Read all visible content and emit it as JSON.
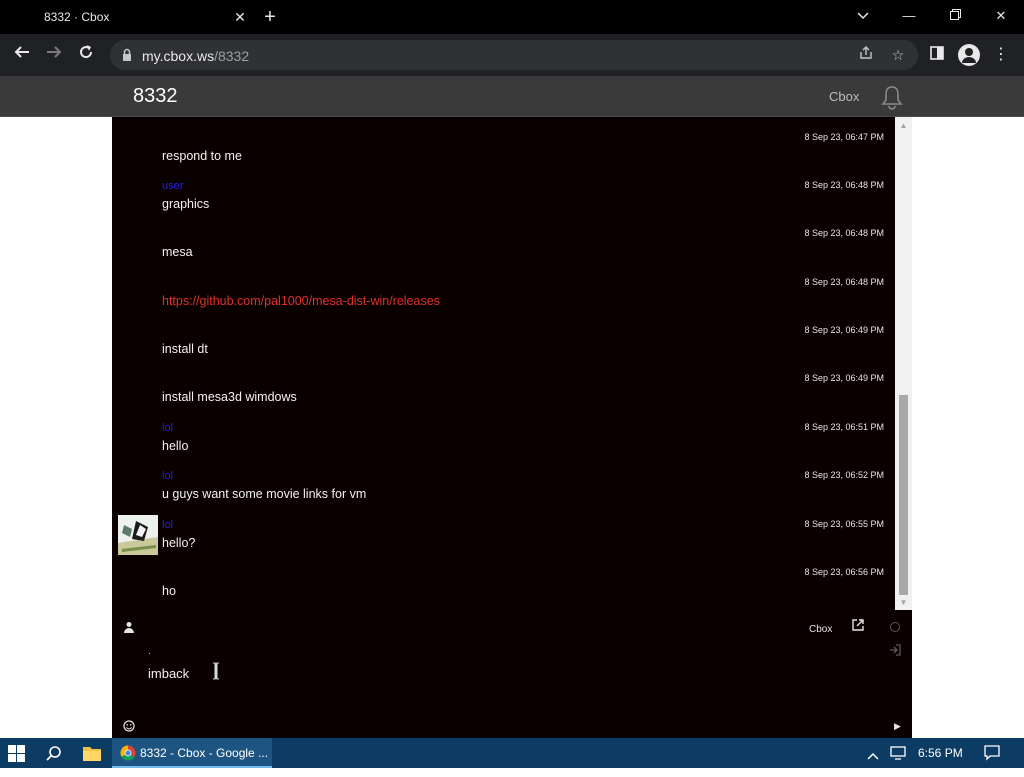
{
  "browser": {
    "tab_title": "8332 · Cbox",
    "url_host": "my.cbox.ws",
    "url_path": "/8332"
  },
  "cbox": {
    "title": "8332",
    "brand": "Cbox"
  },
  "messages": [
    {
      "nick": "",
      "time": "8 Sep 23, 06:47 PM",
      "text": "respond to me",
      "link": false,
      "avatar": false
    },
    {
      "nick": "user",
      "time": "8 Sep 23, 06:48 PM",
      "text": "graphics",
      "link": false,
      "avatar": false
    },
    {
      "nick": "",
      "time": "8 Sep 23, 06:48 PM",
      "text": "mesa",
      "link": false,
      "avatar": false
    },
    {
      "nick": "",
      "time": "8 Sep 23, 06:48 PM",
      "text": "https://github.com/pal1000/mesa-dist-win/releases",
      "link": true,
      "avatar": false
    },
    {
      "nick": "",
      "time": "8 Sep 23, 06:49 PM",
      "text": "install dt",
      "link": false,
      "avatar": false
    },
    {
      "nick": "",
      "time": "8 Sep 23, 06:49 PM",
      "text": "install mesa3d wimdows",
      "link": false,
      "avatar": false
    },
    {
      "nick": "lol",
      "time": "8 Sep 23, 06:51 PM",
      "text": "hello",
      "link": false,
      "avatar": false
    },
    {
      "nick": "lol",
      "time": "8 Sep 23, 06:52 PM",
      "text": "u guys want some movie links for vm",
      "link": false,
      "avatar": false
    },
    {
      "nick": "lol",
      "time": "8 Sep 23, 06:55 PM",
      "text": "hello?",
      "link": false,
      "avatar": true
    },
    {
      "nick": "",
      "time": "8 Sep 23, 06:56 PM",
      "text": "ho",
      "link": false,
      "avatar": false
    }
  ],
  "input": {
    "brand_label": "Cbox",
    "name_placeholder": ".",
    "message_value": "imback"
  },
  "taskbar": {
    "chrome_label": "8332 - Cbox - Google ...",
    "clock": "6:56 PM"
  },
  "colors": {
    "chat_bg": "#0a0000",
    "nick": "#2424d8",
    "link": "#e0302a",
    "header": "#3a3a3a"
  }
}
